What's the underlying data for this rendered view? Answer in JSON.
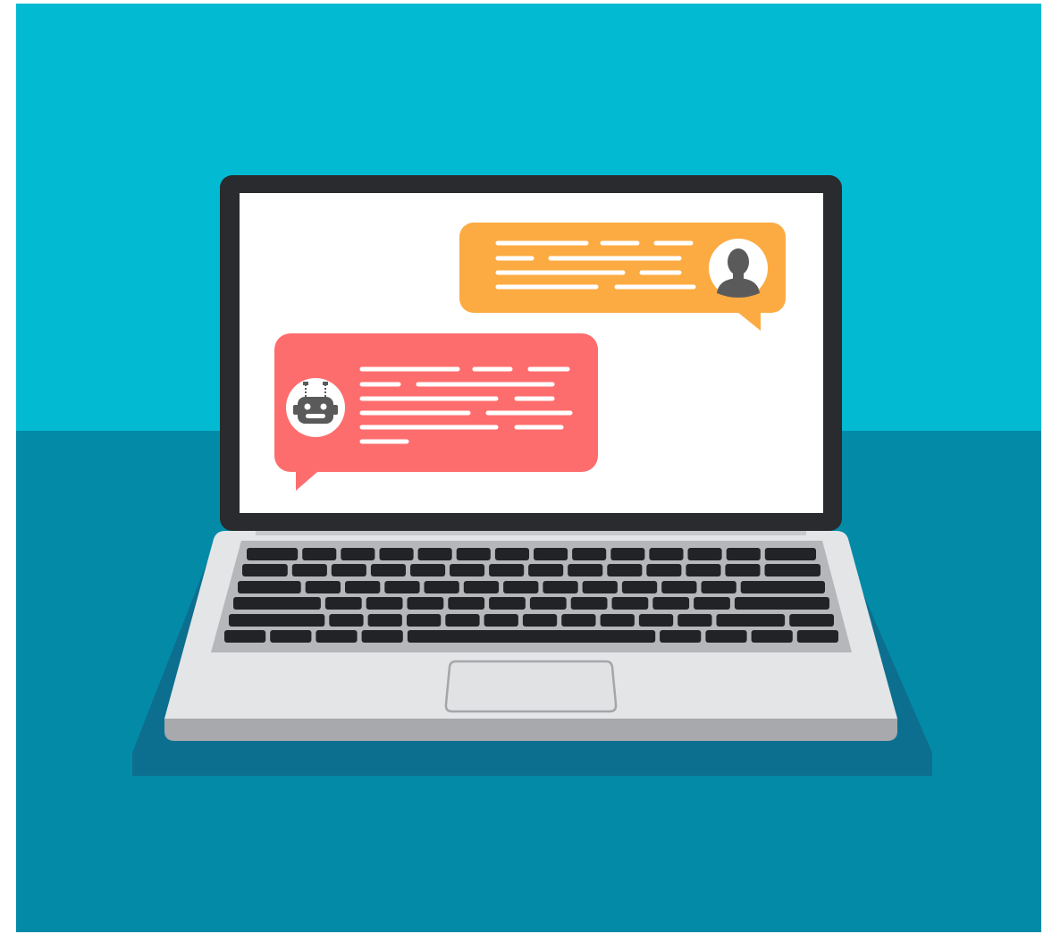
{
  "colors": {
    "page": "#ffffff",
    "wall": "#03bad3",
    "desk": "#038aa7",
    "shadow": "#0d6f8f",
    "bezel": "#2a2b2e",
    "screen": "#ffffff",
    "user_bubble": "#fcab42",
    "bot_bubble": "#fe6d6d",
    "avatar_bg": "#ffffff",
    "avatar_figure": "#5a5a5a",
    "body_top": "#e3e5e7",
    "body_edge": "#a7a9ac",
    "keyboard_well": "#b5b7ba",
    "key": "#222326",
    "trackpad": "#e0e2e4",
    "trackpad_border": "#a4a6a9"
  },
  "icons": {
    "user_avatar": "user-silhouette-icon",
    "bot_avatar": "robot-icon"
  },
  "messages": [
    {
      "sender": "user",
      "text_lines": 4,
      "align": "right"
    },
    {
      "sender": "bot",
      "text_lines": 6,
      "align": "left"
    }
  ],
  "keyboard": {
    "rows": 6
  }
}
